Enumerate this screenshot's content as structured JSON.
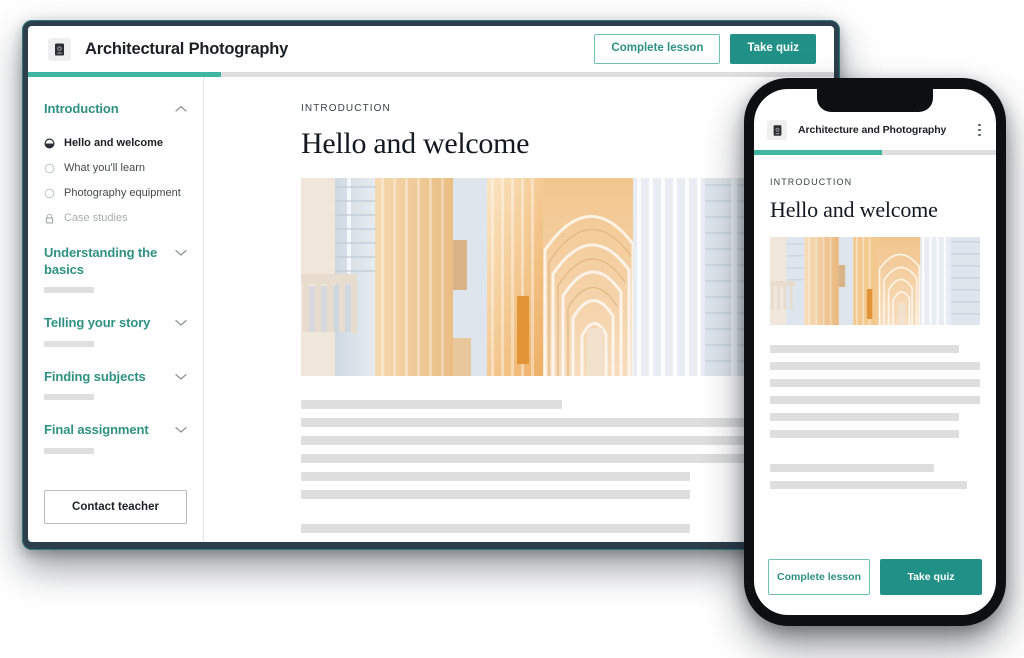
{
  "theme": {
    "accent_teal": "#3eb6a0",
    "accent_teal_dark": "#219187",
    "accent_teal_text": "#2e9183",
    "skeleton_gray": "#dedede",
    "frame_navy": "#2d3e4c",
    "phone_black": "#0d0f11"
  },
  "desktop": {
    "header": {
      "app_icon": "camera-icon",
      "title": "Architectural Photography",
      "complete_label": "Complete lesson",
      "quiz_label": "Take quiz"
    },
    "progress": {
      "percent": 24
    },
    "sidebar": {
      "sections": [
        {
          "title": "Introduction",
          "expanded": true,
          "chevron": "chevron-up-icon",
          "lessons": [
            {
              "label": "Hello and welcome",
              "state": "current",
              "icon": "progress-circle-icon"
            },
            {
              "label": "What you'll learn",
              "state": "todo",
              "icon": "circle-icon"
            },
            {
              "label": "Photography equipment",
              "state": "todo",
              "icon": "circle-icon"
            },
            {
              "label": "Case studies",
              "state": "locked",
              "icon": "lock-icon"
            }
          ]
        },
        {
          "title": "Understanding the basics",
          "expanded": false,
          "chevron": "chevron-down-icon",
          "lessons": []
        },
        {
          "title": "Telling your story",
          "expanded": false,
          "chevron": "chevron-down-icon",
          "lessons": []
        },
        {
          "title": "Finding subjects",
          "expanded": false,
          "chevron": "chevron-down-icon",
          "lessons": []
        },
        {
          "title": "Final assignment",
          "expanded": false,
          "chevron": "chevron-down-icon",
          "lessons": []
        }
      ],
      "contact_label": "Contact teacher"
    },
    "main": {
      "eyebrow": "INTRODUCTION",
      "title": "Hello and welcome",
      "hero_image": "cathedral-interior-photo",
      "skeleton_widths": [
        49,
        99,
        99,
        99,
        73,
        73,
        73,
        92
      ]
    }
  },
  "phone": {
    "header": {
      "app_icon": "camera-icon",
      "title": "Architecture and Photography",
      "menu_icon": "kebab-menu-icon"
    },
    "progress": {
      "percent": 53
    },
    "main": {
      "eyebrow": "INTRODUCTION",
      "title": "Hello and welcome",
      "hero_image": "cathedral-interior-photo",
      "skeleton_widths": [
        90,
        100,
        100,
        100,
        90,
        90,
        78,
        94
      ]
    },
    "footer": {
      "complete_label": "Complete lesson",
      "quiz_label": "Take quiz"
    }
  }
}
